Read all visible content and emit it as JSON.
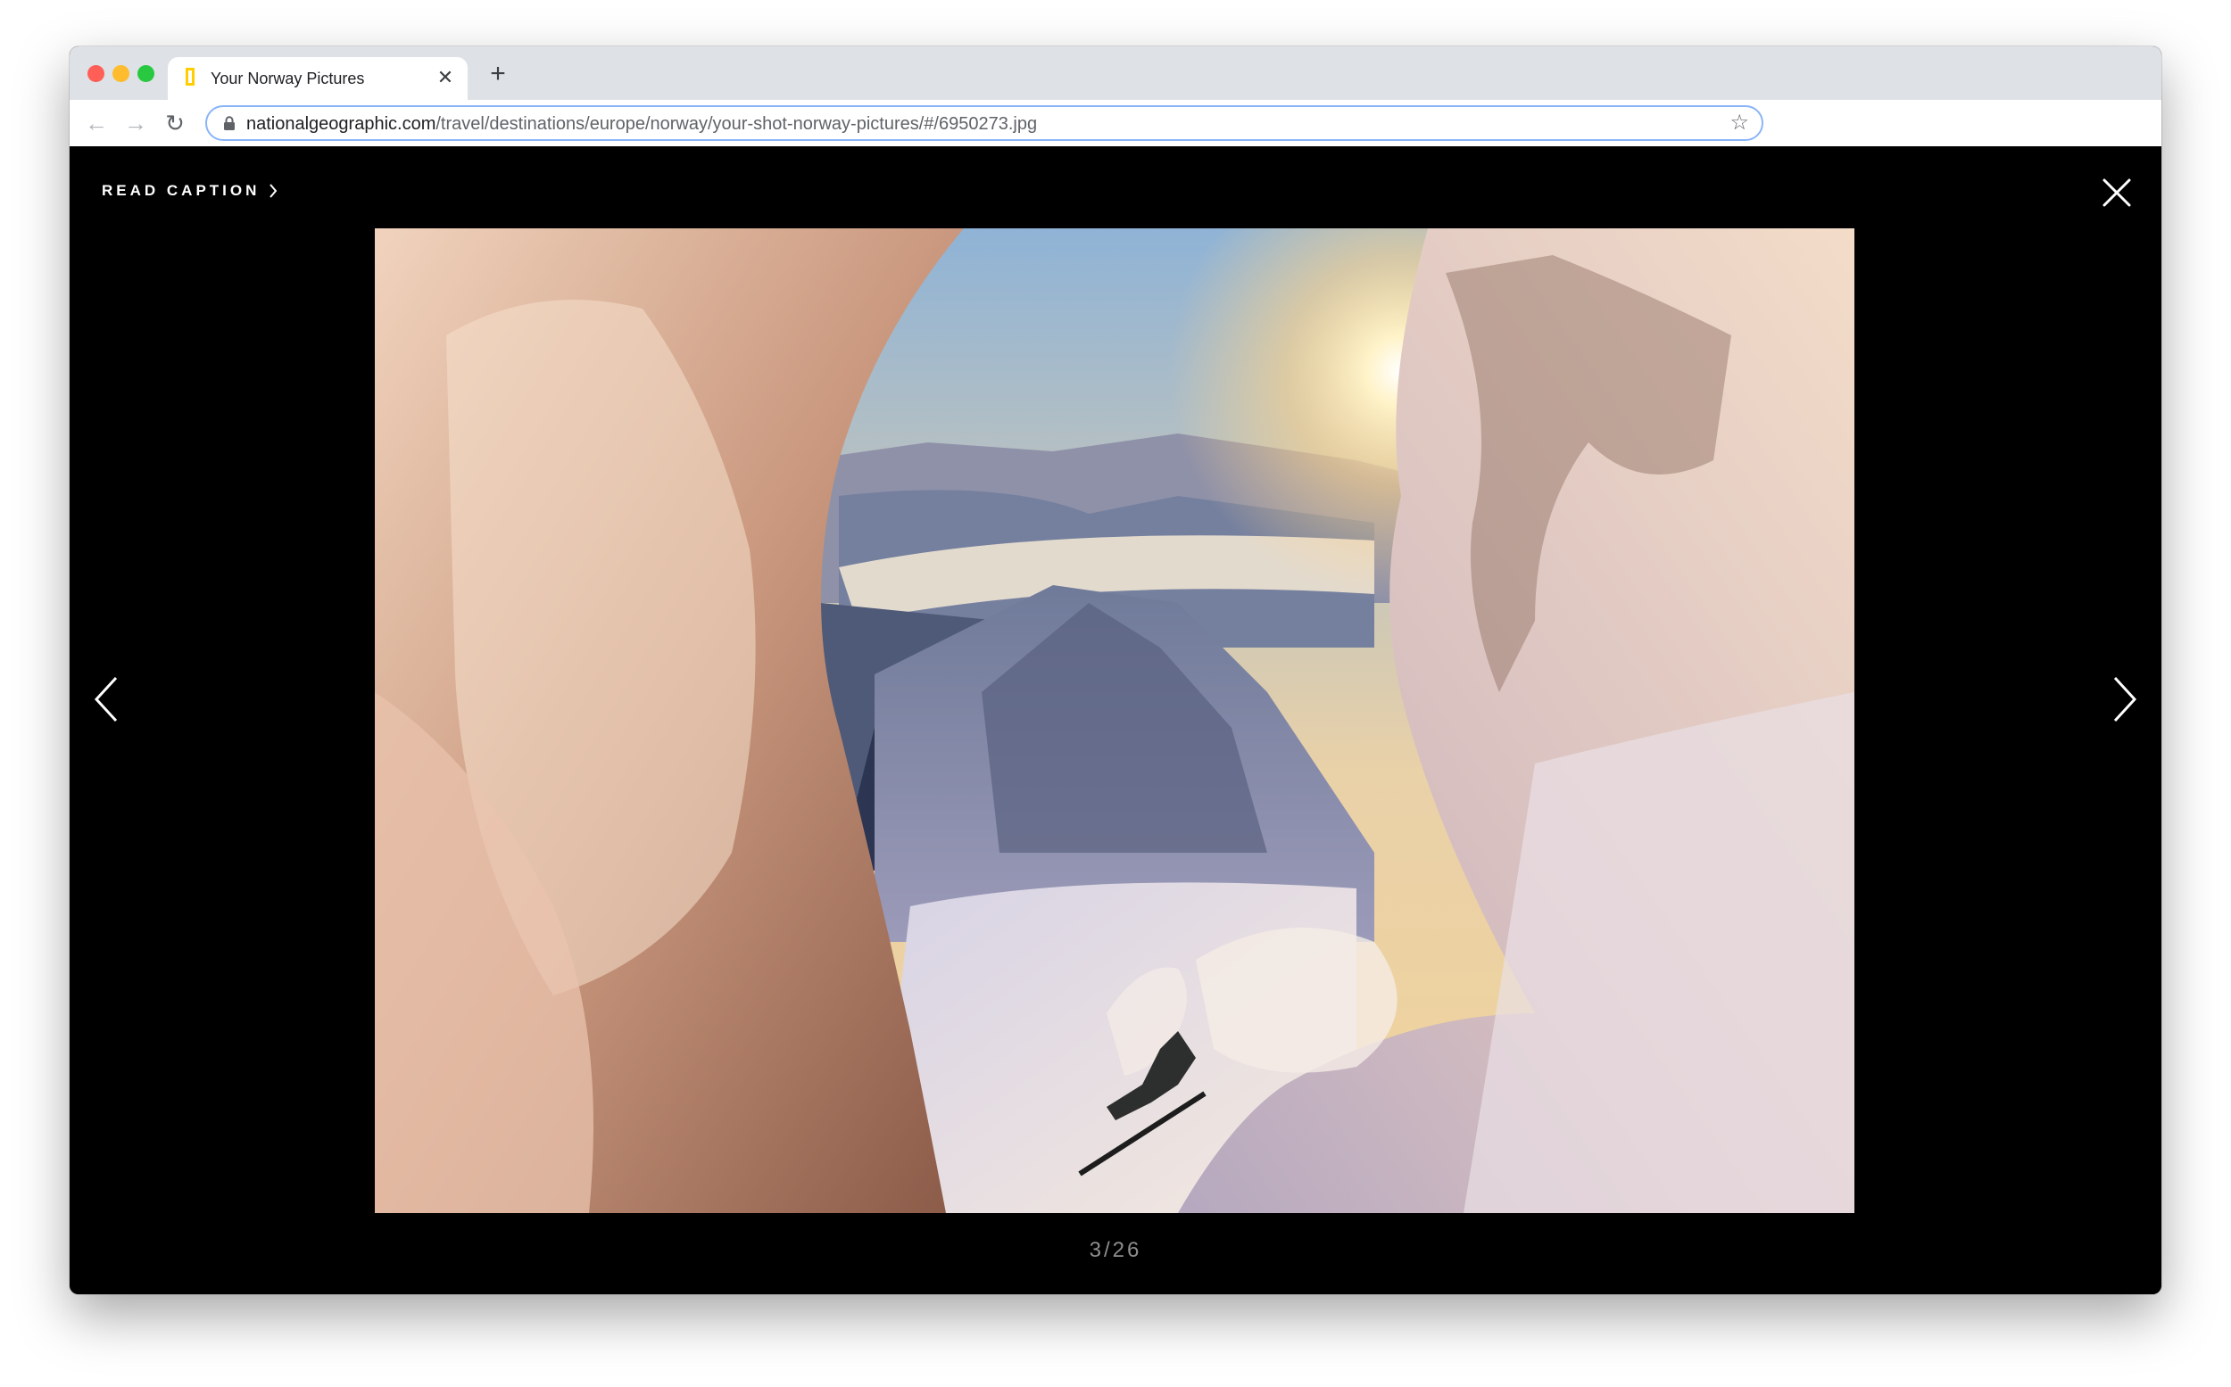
{
  "browser": {
    "tab": {
      "title": "Your Norway Pictures",
      "close_glyph": "✕"
    },
    "new_tab_glyph": "+",
    "nav": {
      "back_glyph": "←",
      "forward_glyph": "→",
      "reload_glyph": "↻"
    },
    "address": {
      "host": "nationalgeographic.com",
      "path": "/travel/destinations/europe/norway/your-shot-norway-pictures/#/6950273.jpg"
    },
    "bookmark_glyph": "☆"
  },
  "gallery": {
    "read_caption_label": "READ CAPTION",
    "counter_text": "3/26",
    "current": 3,
    "total": 26
  },
  "icons": {
    "favicon": "natgeo-yellow-frame-icon",
    "lock": "lock-icon",
    "star": "star-icon",
    "close": "close-icon",
    "prev": "chevron-left-icon",
    "next": "chevron-right-icon",
    "caption_chevron": "chevron-right-icon"
  },
  "colors": {
    "natgeo_yellow": "#ffce00",
    "background": "#000000",
    "counter": "#8e8e8e"
  }
}
